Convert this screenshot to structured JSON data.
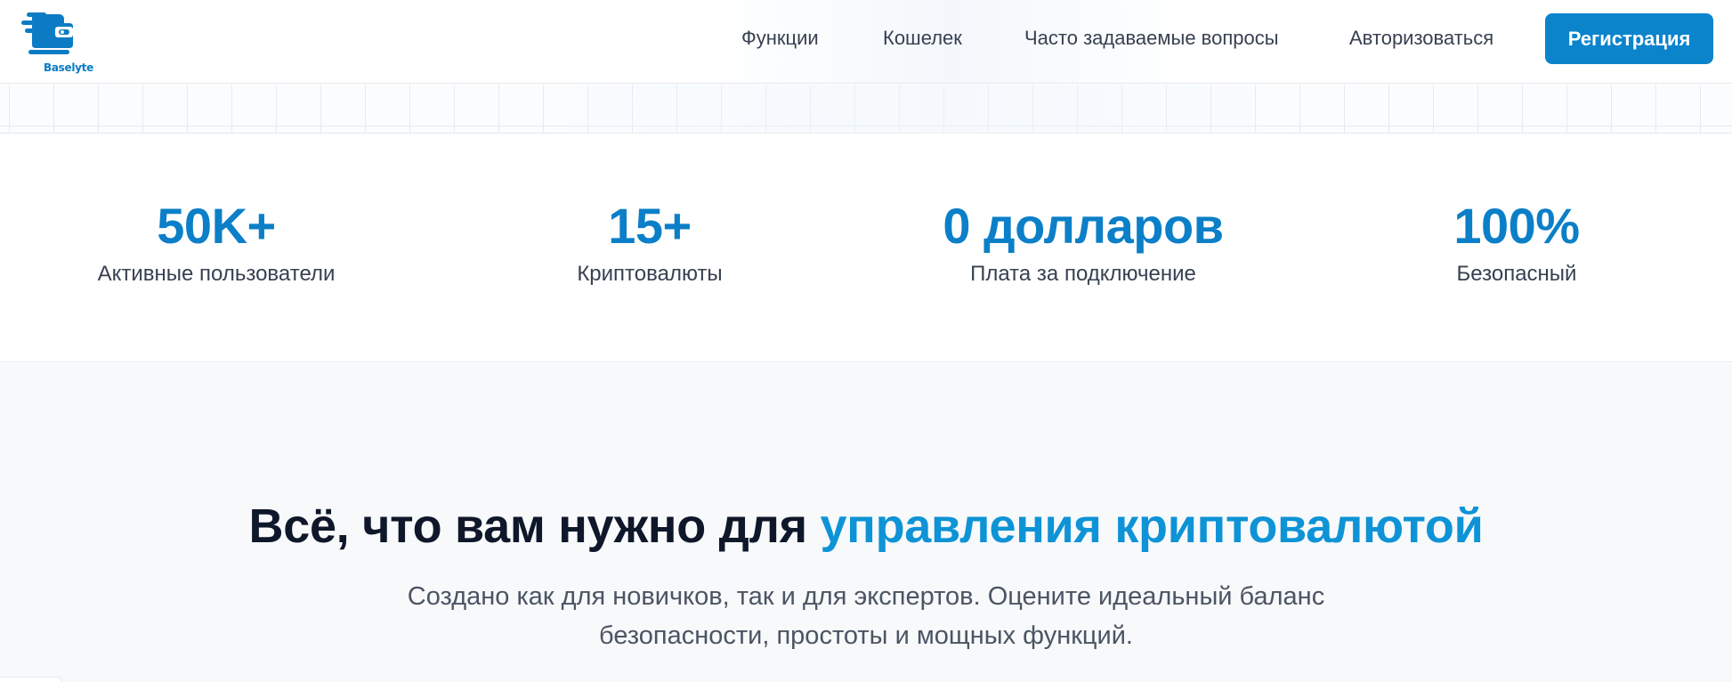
{
  "brand": {
    "name": "Baselyte",
    "color": "#0b7cc4"
  },
  "nav": {
    "items": [
      {
        "label": "Функции"
      },
      {
        "label": "Кошелек"
      },
      {
        "label": "Часто задаваемые вопросы"
      },
      {
        "label": "Авторизоваться"
      }
    ],
    "signup_label": "Регистрация"
  },
  "stats": [
    {
      "value": "50K+",
      "label": "Активные пользователи"
    },
    {
      "value": "15+",
      "label": "Криптовалюты"
    },
    {
      "value": "0 долларов",
      "label": "Плата за подключение"
    },
    {
      "value": "100%",
      "label": "Безопасный"
    }
  ],
  "features": {
    "title_main": "Всё, что вам нужно для ",
    "title_accent": "управления криптовалютой",
    "subtitle_line1": "Создано как для новичков, так и для экспертов. Оцените идеальный баланс",
    "subtitle_line2": "безопасности, простоты и мощных функций."
  },
  "colors": {
    "accent": "#0b84cc",
    "stat_value": "#0b7fc7",
    "title_accent": "#0e93d6",
    "heading": "#0f172a",
    "text": "#374151"
  }
}
